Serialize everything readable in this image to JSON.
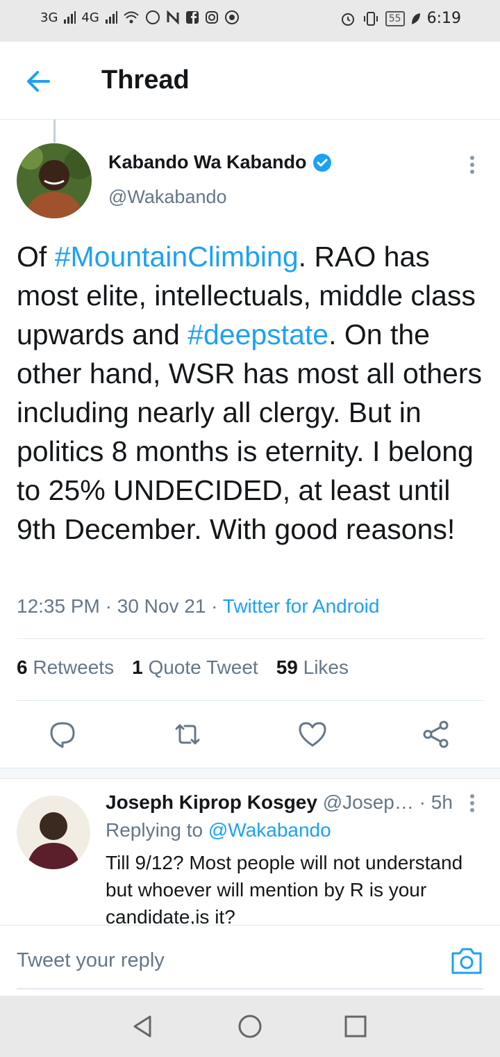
{
  "status_bar": {
    "network_1": "3G",
    "network_2": "4G",
    "battery": "55",
    "time": "6:19"
  },
  "header": {
    "title": "Thread"
  },
  "tweet": {
    "author_name": "Kabando Wa Kabando",
    "handle": "@Wakabando",
    "verified": true,
    "text_parts": [
      "Of ",
      "#MountainClimbing",
      ". RAO has most elite, intellectuals, middle class upwards and ",
      "#deepstate",
      ". On the other hand, WSR has most all others including nearly all clergy. But in politics 8 months is eternity. I belong to 25% UNDECIDED, at least until 9th December. With good reasons!"
    ],
    "time": "12:35 PM",
    "date": "30 Nov 21",
    "source": "Twitter for Android",
    "stats": {
      "retweets_count": "6",
      "retweets_label": "Retweets",
      "quotes_count": "1",
      "quotes_label": "Quote Tweet",
      "likes_count": "59",
      "likes_label": "Likes"
    }
  },
  "reply": {
    "author_name": "Joseph Kiprop Kosgey",
    "handle": "@Josep…",
    "age": "· 5h",
    "replying_prefix": "Replying to",
    "replying_to": "@Wakabando",
    "text": "Till 9/12? Most people will not understand but whoever will mention by R is your candidate,is it?"
  },
  "compose": {
    "placeholder": "Tweet your reply"
  },
  "colors": {
    "accent": "#1da1f2",
    "secondary_text": "#657786",
    "divider": "#e1e8ed"
  },
  "icons": [
    "back-arrow-icon",
    "verified-badge-icon",
    "more-vertical-icon",
    "reply-icon",
    "retweet-icon",
    "like-icon",
    "share-icon",
    "camera-icon",
    "nav-back-icon",
    "nav-home-icon",
    "nav-recents-icon"
  ]
}
